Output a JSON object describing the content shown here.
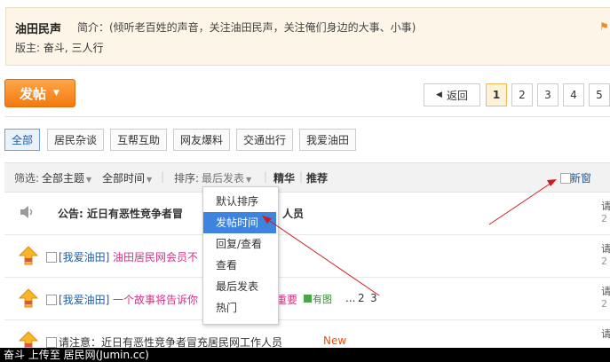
{
  "header": {
    "forum_name": "油田民声",
    "intro": "简介：(倾听老百姓的声音，关注油田民声，关注俺们身边的大事、小事)",
    "moderators_label": "版主:",
    "moderators": "奋斗, 三人行"
  },
  "toolbar": {
    "post_label": "发帖",
    "back_label": "返回",
    "pages": [
      "1",
      "2",
      "3",
      "4",
      "5"
    ],
    "current_page": "1"
  },
  "categories": [
    "全部",
    "居民杂谈",
    "互帮互助",
    "网友爆料",
    "交通出行",
    "我爱油田"
  ],
  "filter": {
    "label": "筛选:",
    "all_topics": "全部主题",
    "all_time": "全部时间",
    "sort_label": "排序:",
    "sort_value": "最后发表",
    "digest": "精华",
    "recommend": "推荐",
    "new_window": "新窗"
  },
  "sort_menu": {
    "items": [
      "默认排序",
      "发帖时间",
      "回复/查看",
      "查看",
      "最后发表",
      "热门"
    ],
    "highlighted": "发帖时间"
  },
  "threads": [
    {
      "type": "announcement",
      "prefix": "公告:",
      "title": "近日有恶性竞争者冒",
      "title_tail": "人员"
    },
    {
      "tag": "[我爱油田]",
      "title": "油田居民网会员不"
    },
    {
      "tag": "[我爱油田]",
      "title": "一个故事将告诉你",
      "title_tail": "重要",
      "attachment": "有图",
      "pages": [
        "...",
        "2",
        "3"
      ]
    },
    {
      "title": "请注意：近日有恶性竞争者冒充居民网工作人员",
      "badge": "New"
    }
  ],
  "colors": {
    "accent_orange": "#f47a0f",
    "link_blue": "#1a5ea8",
    "thread_pink": "#d0338a",
    "menu_highlight": "#3d83e0",
    "annotation_red": "#d31a1a"
  },
  "caption": "奋斗 上传至 居民网(Jumin.cc)"
}
